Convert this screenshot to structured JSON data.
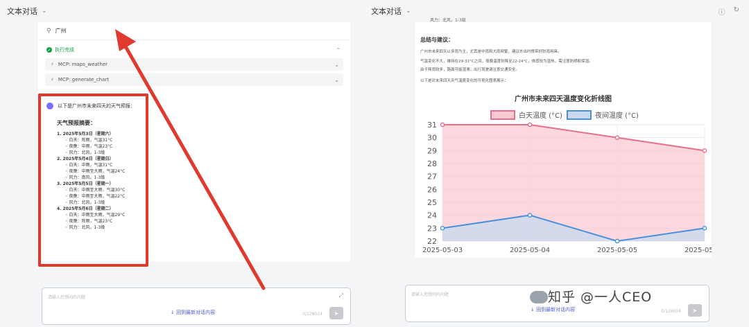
{
  "left": {
    "title": "文本对话",
    "user_message": "广州",
    "exec_status": "执行完成",
    "mcp_tools": [
      "MCP:  maps_weather",
      "MCP:  generate_chart"
    ],
    "answer_intro": "以下是广州市未来四天的天气预报：",
    "answer_heading": "天气预报摘要：",
    "days": [
      {
        "date": "1. 2025年5月3日（星期六）",
        "items": [
          "白天：阵雨，气温31°C",
          "夜晚：中雨，气温23°C",
          "风力：北风，1-3级"
        ]
      },
      {
        "date": "2. 2025年5月4日（星期日）",
        "items": [
          "白天：中雨，气温31°C",
          "夜晚：中雨至大雨，气温24°C",
          "风力：南风，1-3级"
        ]
      },
      {
        "date": "3. 2025年5月5日（星期一）",
        "items": [
          "白天：中雨至大雨，气温30°C",
          "夜晚：中雨至大雨，气温22°C",
          "风力：北风，1-3级"
        ]
      },
      {
        "date": "4. 2025年5月6日（星期二）",
        "items": [
          "白天：中雨至大雨，气温29°C",
          "夜晚：阵雨，气温23°C",
          "风力：北风，1-3级"
        ]
      }
    ],
    "input_placeholder": "请输入您想问的问题",
    "back_to_latest": "回到最新对话内容",
    "char_count": "0/128024"
  },
  "right": {
    "title": "文本对话",
    "fragment": "风力：北风，1-3级",
    "summary_title": "总结与建议：",
    "paragraphs": [
      "广州市未来四天以多雨为主，尤其是中雨和大雨频繁，建议外出时携带好防雨用具。",
      "气温变化不大，维持在29-31°C之间，夜晚温度则降至22-24°C，体感较为湿热，需注意防晒和保湿。",
      "由于降雨较多，路面可能湿滑，出行驾驶请注意交通安全。",
      "以下是对未来四天天气温度变化的可视化图表展示："
    ],
    "input_placeholder": "请输入您想问的问题",
    "back_to_latest": "回到最新对话内容",
    "char_count": "0/128024",
    "watermark": "知乎 @一人CEO"
  },
  "chart_data": {
    "type": "area",
    "title": "广州市未来四天温度变化折线图",
    "categories": [
      "2025-05-03",
      "2025-05-04",
      "2025-05-05",
      "2025-05-06"
    ],
    "series": [
      {
        "name": "白天温度 (°C)",
        "values": [
          31,
          31,
          30,
          29
        ],
        "color": "#e6708a",
        "fill": "#f9c9d3"
      },
      {
        "name": "夜间温度 (°C)",
        "values": [
          23,
          24,
          22,
          23
        ],
        "color": "#4a90d9",
        "fill": "#c8d9f0"
      }
    ],
    "ylim": [
      22,
      31
    ],
    "yticks": [
      "22",
      "23",
      "24",
      "25",
      "26",
      "27",
      "28",
      "29",
      "30",
      "31"
    ],
    "grid": true,
    "legend": "top"
  },
  "colors": {
    "accent": "#4a5cd6",
    "success": "#1a9e4b",
    "annotation": "#e03a2f"
  },
  "icons": {
    "user": "user-icon",
    "check": "check-circle-icon",
    "tool": "tool-icon",
    "send": "send-icon",
    "expand": "expand-icon",
    "arrow-down": "arrow-down-icon",
    "info": "info-icon",
    "refresh": "refresh-icon"
  }
}
